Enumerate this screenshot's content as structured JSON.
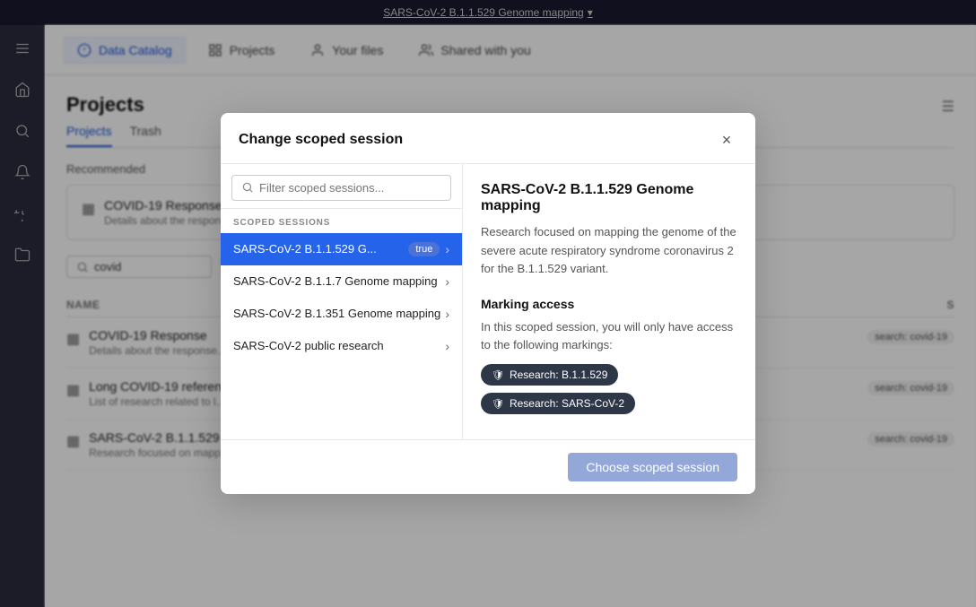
{
  "topbar": {
    "title": "SARS-CoV-2 B.1.1.529 Genome mapping",
    "caret": "▾"
  },
  "nav": {
    "tabs": [
      {
        "id": "data-catalog",
        "label": "Data Catalog",
        "icon": "catalog",
        "active": true
      },
      {
        "id": "projects",
        "label": "Projects",
        "icon": "projects",
        "active": false
      },
      {
        "id": "your-files",
        "label": "Your files",
        "icon": "user",
        "active": false
      },
      {
        "id": "shared-with-you",
        "label": "Shared with you",
        "icon": "share",
        "active": false
      }
    ]
  },
  "page": {
    "title": "Projects",
    "tabs": [
      "Projects",
      "Trash"
    ],
    "active_tab": "Projects"
  },
  "recommended": {
    "label": "Recommended",
    "item": {
      "title": "COVID-19 Response",
      "description": "Details about the response i..."
    }
  },
  "search": {
    "value": "covid",
    "placeholder": "covid"
  },
  "toolbar_buttons": {
    "center": "Center",
    "color": "Color",
    "more": "More"
  },
  "table": {
    "columns": [
      "NAME",
      "S"
    ],
    "rows": [
      {
        "title": "COVID-19 Response",
        "description": "Details about the response...",
        "tag": "search: covid-19"
      },
      {
        "title": "Long COVID-19 references",
        "description": "List of research related to l...",
        "tag": "search: covid-19"
      },
      {
        "title": "SARS-CoV-2 B.1.1.529 Gen...",
        "description": "Research focused on mapp...",
        "tag": "search: covid-19"
      }
    ]
  },
  "modal": {
    "title": "Change scoped session",
    "close_label": "×",
    "filter": {
      "placeholder": "Filter scoped sessions..."
    },
    "sessions_label": "SCOPED SESSIONS",
    "sessions": [
      {
        "id": "sars-529",
        "label": "SARS-CoV-2 B.1.1.529 G...",
        "current": true,
        "active": true
      },
      {
        "id": "sars-117",
        "label": "SARS-CoV-2 B.1.1.7 Genome mapping",
        "current": false,
        "active": false
      },
      {
        "id": "sars-351",
        "label": "SARS-CoV-2 B.1.351 Genome mapping",
        "current": false,
        "active": false
      },
      {
        "id": "sars-public",
        "label": "SARS-CoV-2 public research",
        "current": false,
        "active": false
      }
    ],
    "detail": {
      "title": "SARS-CoV-2 B.1.1.529 Genome mapping",
      "description": "Research focused on mapping the genome of the severe acute respiratory syndrome coronavirus 2 for the B.1.1.529 variant.",
      "marking_access_title": "Marking access",
      "marking_access_desc": "In this scoped session, you will only have access to the following markings:",
      "markings": [
        {
          "label": "Research: B.1.1.529"
        },
        {
          "label": "Research: SARS-CoV-2"
        }
      ]
    },
    "choose_button": "Choose scoped session"
  }
}
